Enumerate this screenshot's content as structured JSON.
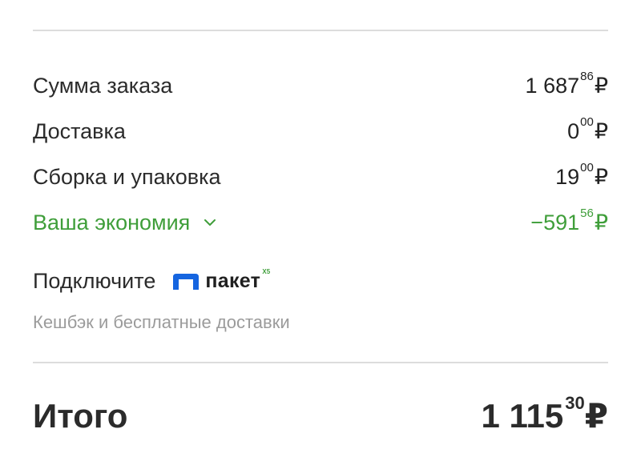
{
  "summary": {
    "order_sum": {
      "label": "Сумма заказа",
      "int": "1 687",
      "frac": "86",
      "currency": "₽"
    },
    "delivery": {
      "label": "Доставка",
      "int": "0",
      "frac": "00",
      "currency": "₽"
    },
    "assembly": {
      "label": "Сборка и упаковка",
      "int": "19",
      "frac": "00",
      "currency": "₽"
    },
    "savings": {
      "label": "Ваша экономия",
      "int": "−591",
      "frac": "56",
      "currency": "₽",
      "color": "#3f9e3a"
    }
  },
  "promo": {
    "connect_label": "Подключите",
    "brand_word": "пакет",
    "brand_badge": "X5",
    "brand_color": "#1565e0",
    "subtext": "Кешбэк и бесплатные доставки"
  },
  "total": {
    "label": "Итого",
    "int": "1 115",
    "frac": "30",
    "currency": "₽"
  }
}
